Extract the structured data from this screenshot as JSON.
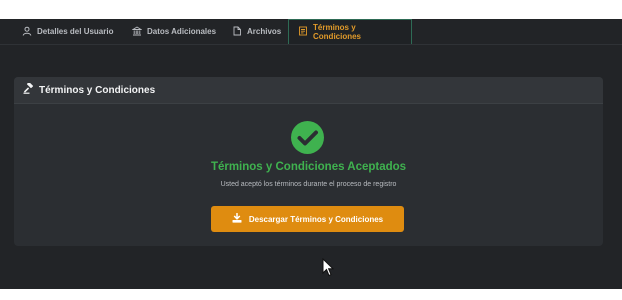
{
  "tabs": [
    {
      "label": "Detalles del Usuario",
      "icon": "user-icon"
    },
    {
      "label": "Datos Adicionales",
      "icon": "bank-icon"
    },
    {
      "label": "Archivos",
      "icon": "file-icon"
    },
    {
      "label": "Términos y Condiciones",
      "icon": "document-list-icon",
      "active": true
    }
  ],
  "card": {
    "title": "Términos y Condiciones",
    "icon": "gavel-icon",
    "status_icon": "check-circle-icon",
    "accepted_title": "Términos y Condiciones Aceptados",
    "accepted_subtitle": "Usted aceptó los términos durante el proceso de registro",
    "download_label": "Descargar Términos y Condiciones",
    "download_icon": "download-icon"
  },
  "colors": {
    "accent": "#df8c10",
    "success": "#3fb24f",
    "background": "#222427",
    "card": "#2b2e32"
  }
}
